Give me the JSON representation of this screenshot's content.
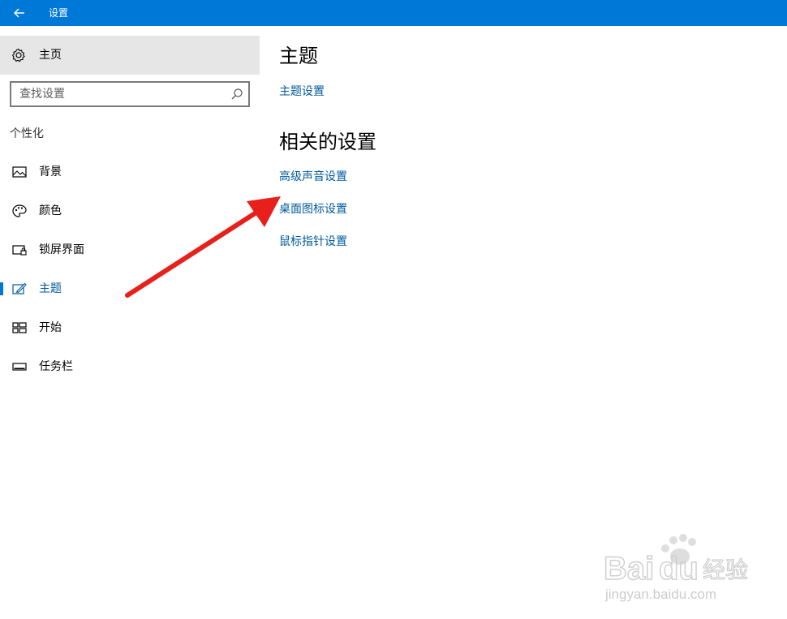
{
  "titlebar": {
    "title": "设置",
    "back_icon": "arrow-left-icon",
    "color": "#0078d7"
  },
  "sidebar": {
    "home_label": "主页",
    "search_placeholder": "查找设置",
    "section_label": "个性化",
    "items": [
      {
        "label": "背景",
        "icon": "picture-icon"
      },
      {
        "label": "颜色",
        "icon": "palette-icon"
      },
      {
        "label": "锁屏界面",
        "icon": "lock-screen-icon"
      },
      {
        "label": "主题",
        "icon": "theme-brush-icon",
        "active": true
      },
      {
        "label": "开始",
        "icon": "start-tiles-icon"
      },
      {
        "label": "任务栏",
        "icon": "taskbar-icon"
      }
    ]
  },
  "main": {
    "heading": "主题",
    "theme_settings_link": "主题设置",
    "related_heading": "相关的设置",
    "related_links": [
      "高级声音设置",
      "桌面图标设置",
      "鼠标指针设置"
    ]
  },
  "annotation": {
    "arrow_color": "#e8201c"
  },
  "watermark": {
    "brand": "Baidu经验",
    "url": "jingyan.baidu.com"
  }
}
